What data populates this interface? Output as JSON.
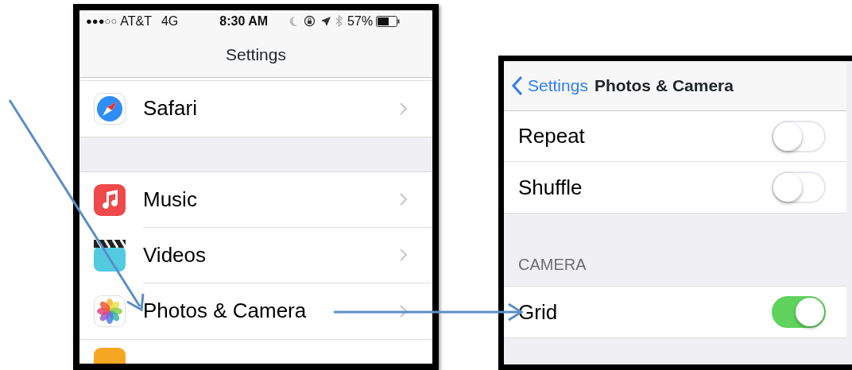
{
  "left_screen": {
    "status_bar": {
      "signal": "●●●○○",
      "carrier": "AT&T",
      "network": "4G",
      "time": "8:30 AM",
      "battery": "57%"
    },
    "title": "Settings",
    "groups": [
      [
        {
          "label": "Safari"
        }
      ],
      [
        {
          "label": "Music"
        },
        {
          "label": "Videos"
        },
        {
          "label": "Photos & Camera"
        }
      ]
    ]
  },
  "right_screen": {
    "back_label": "Settings",
    "title": "Photos & Camera",
    "sections": [
      {
        "rows": [
          {
            "label": "Repeat",
            "on": false
          },
          {
            "label": "Shuffle",
            "on": false
          }
        ]
      },
      {
        "header": "CAMERA",
        "rows": [
          {
            "label": "Grid",
            "on": true
          }
        ]
      }
    ]
  }
}
